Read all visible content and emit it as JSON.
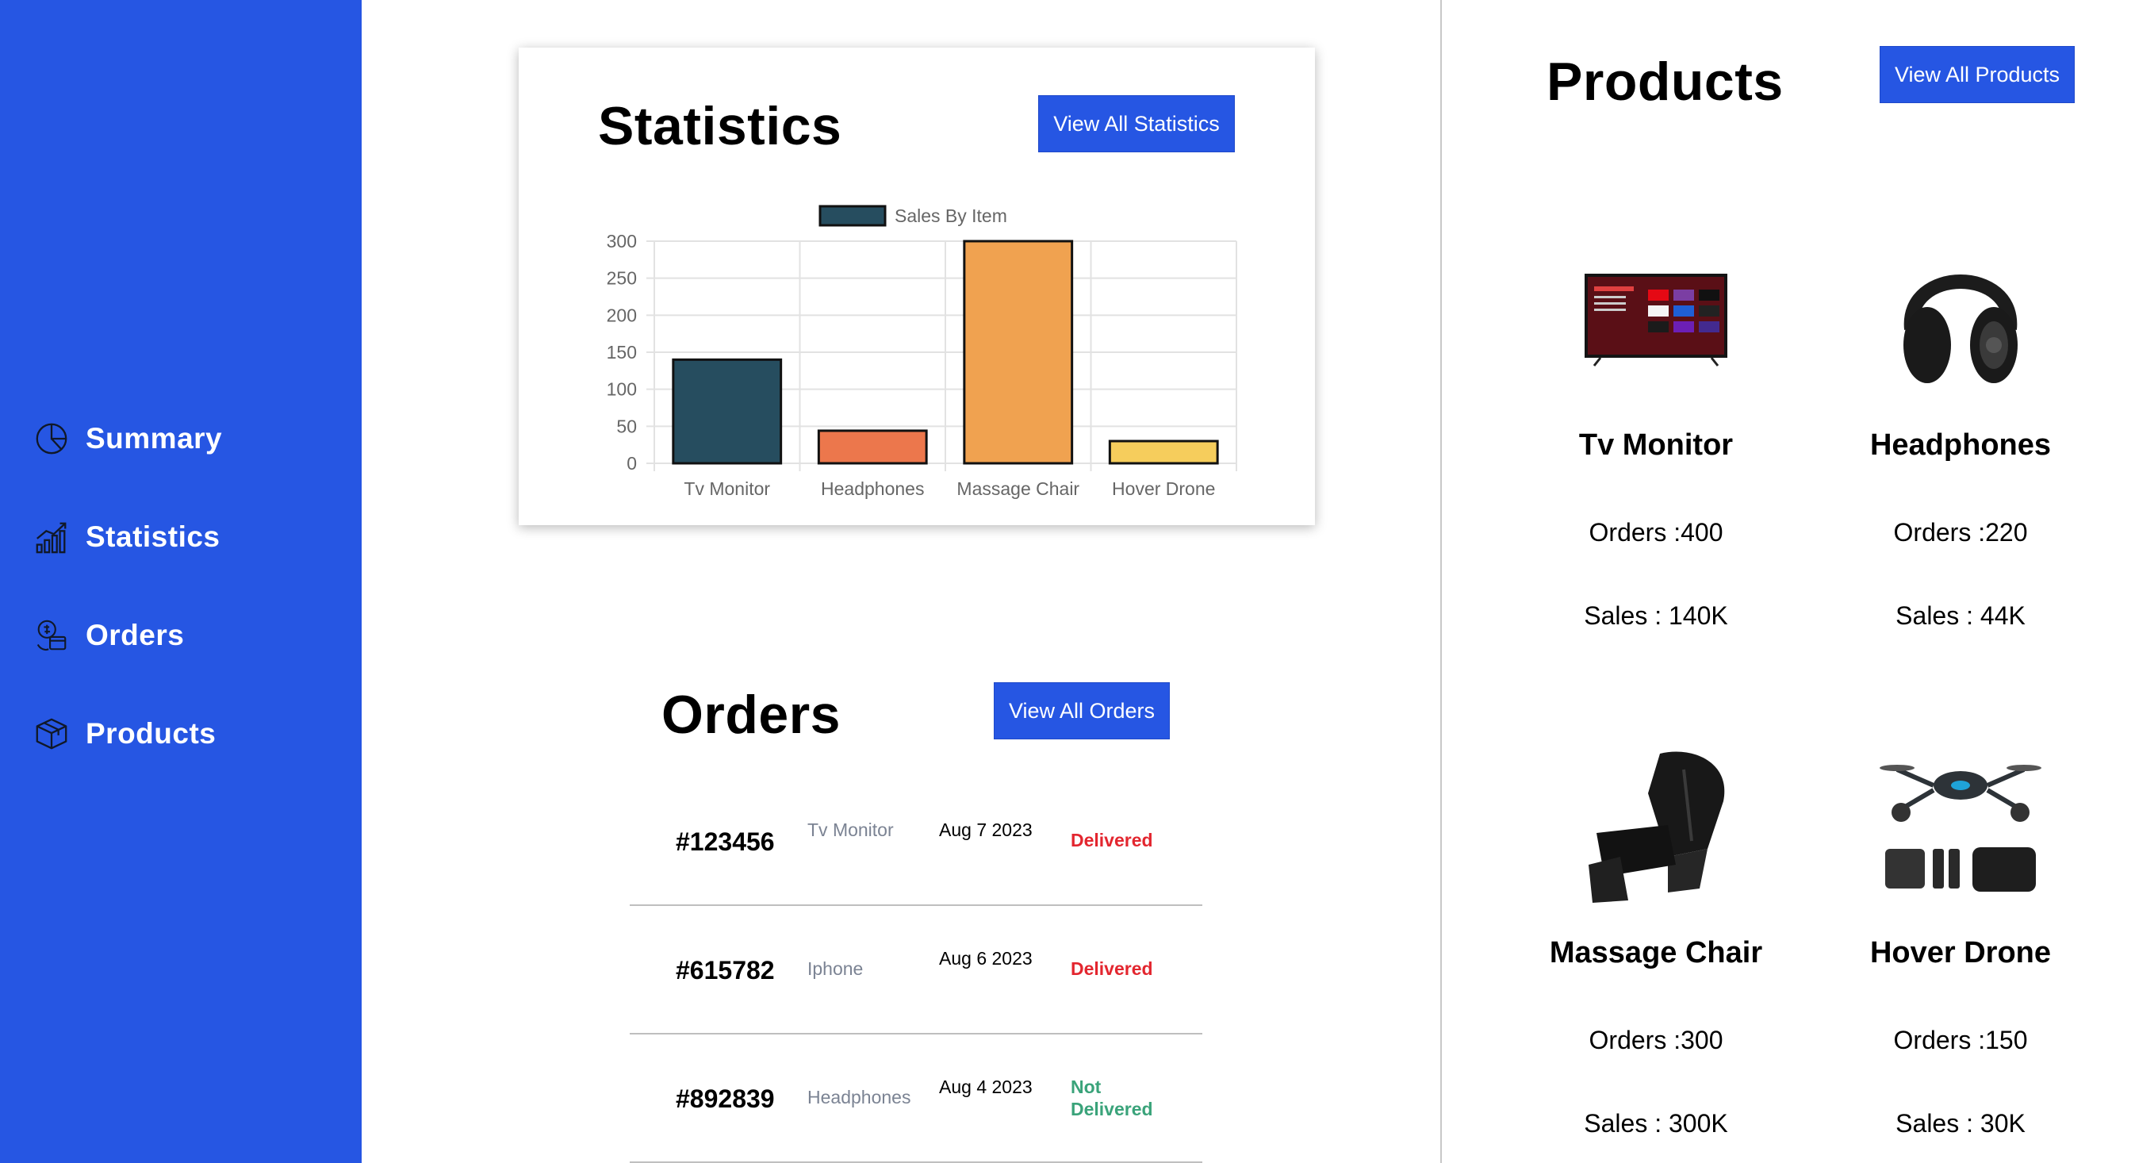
{
  "sidebar": {
    "items": [
      {
        "label": "Summary",
        "icon": "pie-chart-icon"
      },
      {
        "label": "Statistics",
        "icon": "growth-chart-icon"
      },
      {
        "label": "Orders",
        "icon": "orders-icon"
      },
      {
        "label": "Products",
        "icon": "box-icon"
      }
    ]
  },
  "statistics": {
    "title": "Statistics",
    "button_label": "View All Statistics"
  },
  "chart_data": {
    "type": "bar",
    "categories": [
      "Tv Monitor",
      "Headphones",
      "Massage Chair",
      "Hover Drone"
    ],
    "series": [
      {
        "name": "Sales By Item",
        "values": [
          140,
          44,
          300,
          30
        ]
      }
    ],
    "colors": [
      "#264d5f",
      "#ec774c",
      "#f0a250",
      "#f6cd5c"
    ],
    "legend_color": "#264d5f",
    "ylim": [
      0,
      300
    ],
    "yticks": [
      "0",
      "50",
      "100",
      "150",
      "200",
      "250",
      "300"
    ],
    "legend": "top-center",
    "grid": true
  },
  "orders": {
    "title": "Orders",
    "button_label": "View All Orders",
    "rows": [
      {
        "id": "#123456",
        "product": "Tv Monitor",
        "date": "Aug 7 2023",
        "status": "Delivered",
        "status_color": "#e3262f"
      },
      {
        "id": "#615782",
        "product": "Iphone",
        "date": "Aug 6 2023",
        "status": "Delivered",
        "status_color": "#e3262f"
      },
      {
        "id": "#892839",
        "product": "Headphones",
        "date": "Aug 4 2023",
        "status": "Not Delivered",
        "status_color": "#3aa37a"
      }
    ]
  },
  "products": {
    "title": "Products",
    "button_label": "View All Products",
    "items": [
      {
        "name": "Tv Monitor",
        "orders": "Orders :400",
        "sales": "Sales : 140K",
        "image": "tv-monitor-image"
      },
      {
        "name": "Headphones",
        "orders": "Orders :220",
        "sales": "Sales : 44K",
        "image": "headphones-image"
      },
      {
        "name": "Massage Chair",
        "orders": "Orders :300",
        "sales": "Sales : 300K",
        "image": "massage-chair-image"
      },
      {
        "name": "Hover Drone",
        "orders": "Orders :150",
        "sales": "Sales : 30K",
        "image": "drone-image"
      }
    ]
  },
  "accent_color": "#2656e3"
}
